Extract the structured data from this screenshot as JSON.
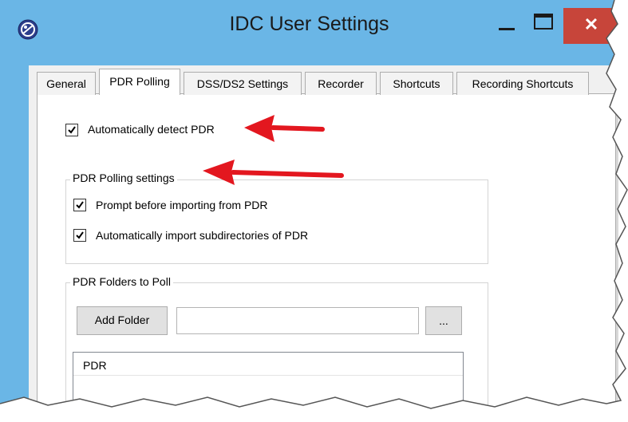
{
  "window": {
    "title": "IDC User Settings",
    "close_glyph": "✕",
    "colors": {
      "frame": "#6ab6e6",
      "close": "#c7453a",
      "annotation_arrow": "#e3171f"
    },
    "icons": [
      "app-icon",
      "minimize-icon",
      "maximize-icon",
      "close-icon"
    ]
  },
  "tabs": [
    {
      "label": "General"
    },
    {
      "label": "PDR Polling",
      "active": true
    },
    {
      "label": "DSS/DS2 Settings"
    },
    {
      "label": "Recorder"
    },
    {
      "label": "Shortcuts"
    },
    {
      "label": "Recording Shortcuts"
    }
  ],
  "pdr_polling": {
    "auto_detect": {
      "label": "Automatically detect PDR",
      "checked": true
    },
    "settings_group": {
      "title": "PDR Polling settings",
      "prompt_before_import": {
        "label": "Prompt before importing from PDR",
        "checked": true
      },
      "import_subdirectories": {
        "label": "Automatically import subdirectories of PDR",
        "checked": true
      }
    },
    "folders_group": {
      "title": "PDR Folders to Poll",
      "add_folder_label": "Add Folder",
      "folder_path_value": "",
      "browse_label": "...",
      "list_header": "PDR"
    }
  }
}
